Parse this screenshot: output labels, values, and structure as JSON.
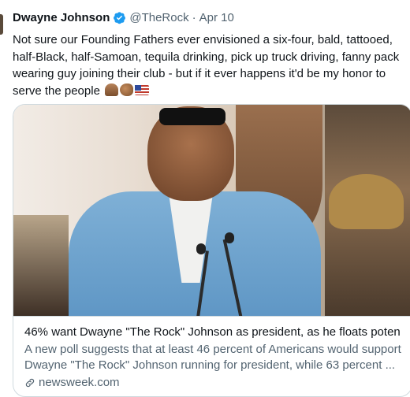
{
  "tweet": {
    "author_name": "Dwayne Johnson",
    "handle": "@TheRock",
    "separator": "·",
    "date": "Apr 10",
    "verified": true,
    "text_lines": [
      "Not sure our Founding Fathers ever envisioned a six-four, bald, tattooed,",
      "half-Black, half-Samoan, tequila drinking, pick up truck driving, fanny pack",
      "wearing guy joining their club - but if it ever happens it'd be my honor to",
      "serve the people"
    ],
    "emojis": [
      "folded-hands-medium-dark-skin",
      "flexed-biceps-medium-dark-skin",
      "flag-united-states"
    ]
  },
  "card": {
    "image_alt": "Man in light blue suit speaking at microphones in front of movie poster",
    "title": "46% want Dwayne \"The Rock\" Johnson as president, as he floats poten...",
    "description_lines": [
      "A new poll suggests that at least 46 percent of Americans would support",
      "Dwayne \"The Rock\" Johnson running for president, while 63 percent ..."
    ],
    "domain": "newsweek.com",
    "link_icon": "link-icon"
  },
  "colors": {
    "text_primary": "#0f1419",
    "text_secondary": "#536471",
    "verified_blue": "#1d9bf0",
    "border": "#cfd9de"
  }
}
